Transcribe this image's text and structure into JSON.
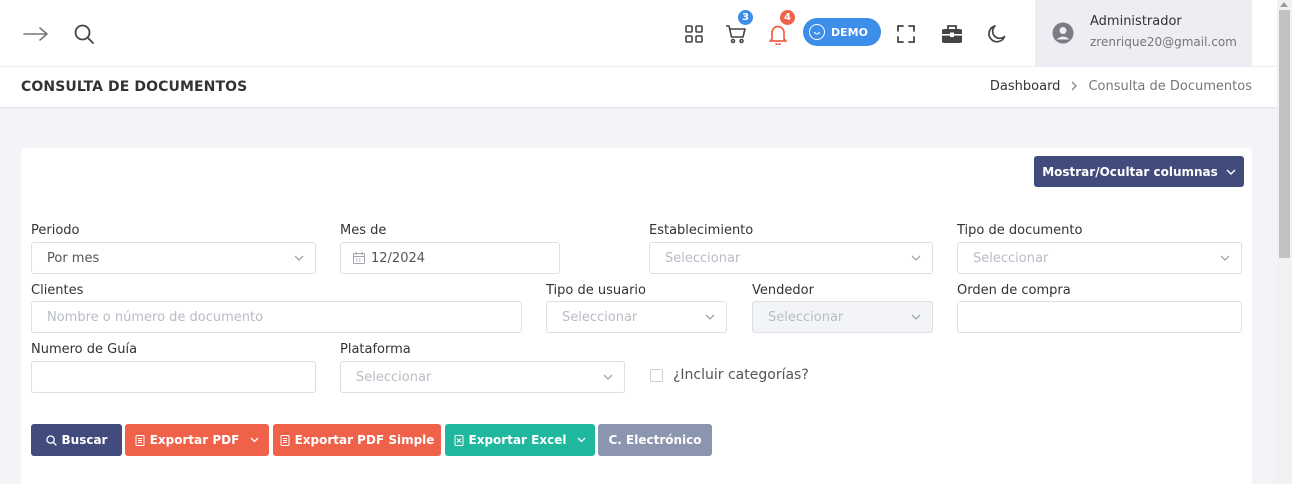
{
  "topbar": {
    "cart_count": "3",
    "notifications_count": "4",
    "demo_label": "DEMO",
    "user_name": "Administrador",
    "user_email": "zrenrique20@gmail.com",
    "colors": {
      "cart_badge": "#3d8ee8",
      "notif_badge": "#f0614a",
      "demo": "#3d8ee8"
    }
  },
  "header": {
    "title": "CONSULTA DE DOCUMENTOS",
    "breadcrumb": [
      "Dashboard",
      "Consulta de Documentos"
    ]
  },
  "columns_button": "Mostrar/Ocultar columnas",
  "filters": {
    "periodo": {
      "label": "Periodo",
      "value": "Por mes"
    },
    "mes": {
      "label": "Mes de",
      "value": "12/2024"
    },
    "establecimiento": {
      "label": "Establecimiento",
      "placeholder": "Seleccionar"
    },
    "tipo_documento": {
      "label": "Tipo de documento",
      "placeholder": "Seleccionar"
    },
    "clientes": {
      "label": "Clientes",
      "placeholder": "Nombre o número de documento"
    },
    "tipo_usuario": {
      "label": "Tipo de usuario",
      "placeholder": "Seleccionar"
    },
    "vendedor": {
      "label": "Vendedor",
      "placeholder": "Seleccionar"
    },
    "orden_compra": {
      "label": "Orden de compra",
      "value": ""
    },
    "numero_guia": {
      "label": "Numero de Guía",
      "value": ""
    },
    "plataforma": {
      "label": "Plataforma",
      "placeholder": "Seleccionar"
    },
    "incluir_categorias": {
      "label": "¿Incluir categorías?",
      "checked": false
    }
  },
  "actions": {
    "buscar": "Buscar",
    "exportar_pdf": "Exportar PDF",
    "exportar_pdf_simple": "Exportar PDF Simple",
    "exportar_excel": "Exportar Excel",
    "c_electronico": "C. Electrónico",
    "colors": {
      "primary": "#414b7c",
      "danger": "#f0614a",
      "success": "#1fb89e",
      "muted": "#8c95b0"
    }
  }
}
